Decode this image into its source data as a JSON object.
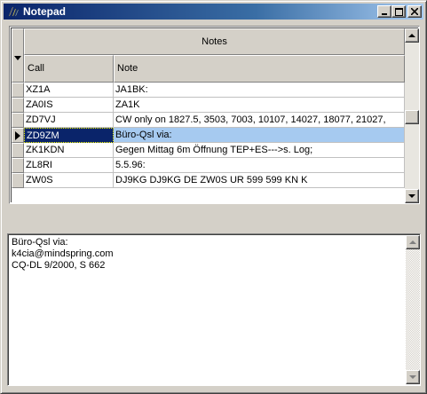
{
  "window": {
    "title": "Notepad",
    "controls": {
      "minimize": "minimize-icon",
      "maximize": "maximize-icon",
      "close": "close-icon"
    }
  },
  "grid": {
    "group_header": "Notes",
    "columns": [
      "Call",
      "Note"
    ],
    "rows": [
      {
        "call": "XZ1A",
        "note": "JA1BK:"
      },
      {
        "call": "ZA0IS",
        "note": "ZA1K"
      },
      {
        "call": "ZD7VJ",
        "note": "CW only on 1827.5, 3503, 7003, 10107, 14027, 18077, 21027,"
      },
      {
        "call": "ZD9ZM",
        "note": "Büro-Qsl via:"
      },
      {
        "call": "ZK1KDN",
        "note": "Gegen Mittag 6m Öffnung TEP+ES--->s. Log;"
      },
      {
        "call": "ZL8RI",
        "note": "5.5.96:"
      },
      {
        "call": "ZW0S",
        "note": "DJ9KG DJ9KG DE ZW0S UR 599 599 KN K"
      }
    ],
    "selected_index": 3
  },
  "memo": {
    "lines": [
      "Büro-Qsl via:",
      "k4cia@mindspring.com",
      "CQ-DL 9/2000, S 662"
    ]
  },
  "colors": {
    "selection": "#0a246a",
    "row_highlight": "#a6caf0",
    "face": "#d4d0c8"
  }
}
